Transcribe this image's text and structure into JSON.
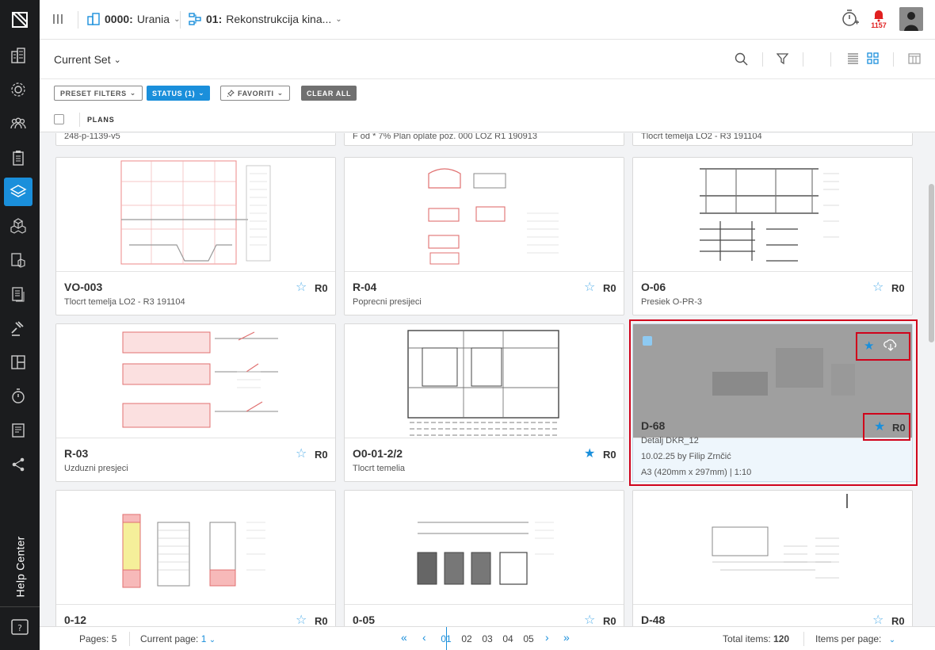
{
  "sidebar": {
    "help_center": "Help Center",
    "icons": [
      "buildings-icon",
      "gear-network-icon",
      "people-icon",
      "clipboard-icon",
      "layers-icon",
      "cubes-icon",
      "documents-cube-icon",
      "list-documents-icon",
      "gavel-icon",
      "layout-icon",
      "stopwatch-icon",
      "report-icon",
      "share-icon"
    ],
    "active_index": 4
  },
  "topbar": {
    "company_code": "0000:",
    "company_name": "Urania",
    "project_code": "01:",
    "project_name": "Rekonstrukcija kina...",
    "notification_count": "1157"
  },
  "toolbar": {
    "current_set": "Current Set"
  },
  "filters": {
    "preset": "PRESET FILTERS",
    "status": "STATUS (1)",
    "favoriti": "FAVORITI",
    "clear": "CLEAR ALL"
  },
  "list_header": {
    "plans": "PLANS"
  },
  "partial_row": [
    {
      "desc": "248-p-1139-v5"
    },
    {
      "desc": "F od * 7% Plan oplate poz. 000 LOZ R1 190913"
    },
    {
      "desc": "Tlocrt temelja LO2 - R3 191104"
    }
  ],
  "cards": [
    {
      "name": "VO-003",
      "desc": "Tlocrt temelja LO2 - R3 191104",
      "rev": "R0",
      "favorite": false
    },
    {
      "name": "R-04",
      "desc": "Poprecni presijeci",
      "rev": "R0",
      "favorite": false
    },
    {
      "name": "O-06",
      "desc": "Presiek O-PR-3",
      "rev": "R0",
      "favorite": false
    },
    {
      "name": "R-03",
      "desc": "Uzduzni presjeci",
      "rev": "R0",
      "favorite": false
    },
    {
      "name": "O0-01-2/2",
      "desc": "Tlocrt temelia",
      "rev": "R0",
      "favorite": true
    },
    {
      "name": "D-68",
      "desc": "Detalj DKR_12",
      "date_line": "10.02.25 by Filip Zrnčić",
      "size_line": "A3 (420mm x 297mm) | 1:10",
      "rev": "R0",
      "favorite": true,
      "selected": true
    },
    {
      "name": "0-12",
      "desc": "",
      "rev": "R0",
      "favorite": false
    },
    {
      "name": "0-05",
      "desc": "",
      "rev": "R0",
      "favorite": false
    },
    {
      "name": "D-48",
      "desc": "",
      "rev": "R0",
      "favorite": false
    }
  ],
  "footer": {
    "pages_label": "Pages:",
    "pages_value": "5",
    "current_page_label": "Current page:",
    "current_page_value": "1",
    "page_numbers": [
      "01",
      "02",
      "03",
      "04",
      "05"
    ],
    "total_label": "Total items:",
    "total_value": "120",
    "per_page_label": "Items per page:"
  },
  "colors": {
    "accent": "#1a8fdb",
    "sidebar": "#1b1c1e",
    "highlight": "#d0021b",
    "alert": "#e02020"
  }
}
